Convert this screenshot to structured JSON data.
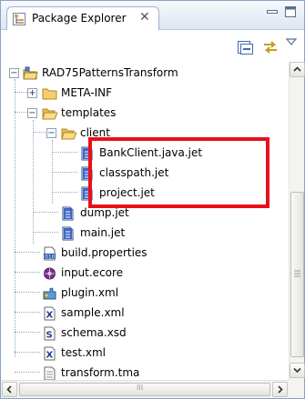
{
  "view": {
    "tab_label": "Package Explorer",
    "tab_close": "✕"
  },
  "colors": {
    "highlight": "#e8101a",
    "tab_border": "#9db3cf"
  },
  "toolbar": {
    "buttons": [
      "collapse-all-icon",
      "link-with-editor-icon",
      "view-menu-icon"
    ]
  },
  "tree": {
    "items": [
      {
        "label": "RAD75PatternsTransform",
        "icon": "project-icon",
        "expander": "−"
      },
      {
        "label": "META-INF",
        "icon": "folder-icon",
        "expander": "+"
      },
      {
        "label": "templates",
        "icon": "folder-open-icon",
        "expander": "−"
      },
      {
        "label": "client",
        "icon": "folder-open-icon",
        "expander": "−"
      },
      {
        "label": "BankClient.java.jet",
        "icon": "file-icon"
      },
      {
        "label": "classpath.jet",
        "icon": "file-icon"
      },
      {
        "label": "project.jet",
        "icon": "file-icon"
      },
      {
        "label": "dump.jet",
        "icon": "file-icon"
      },
      {
        "label": "main.jet",
        "icon": "file-icon"
      },
      {
        "label": "build.properties",
        "icon": "properties-file-icon"
      },
      {
        "label": "input.ecore",
        "icon": "ecore-icon"
      },
      {
        "label": "plugin.xml",
        "icon": "plugin-icon"
      },
      {
        "label": "sample.xml",
        "icon": "xml-file-icon"
      },
      {
        "label": "schema.xsd",
        "icon": "schema-file-icon"
      },
      {
        "label": "test.xml",
        "icon": "xml-file-icon"
      },
      {
        "label": "transform.tma",
        "icon": "file-icon"
      }
    ]
  },
  "scrollbar": {
    "horizontal_grip": "III"
  }
}
